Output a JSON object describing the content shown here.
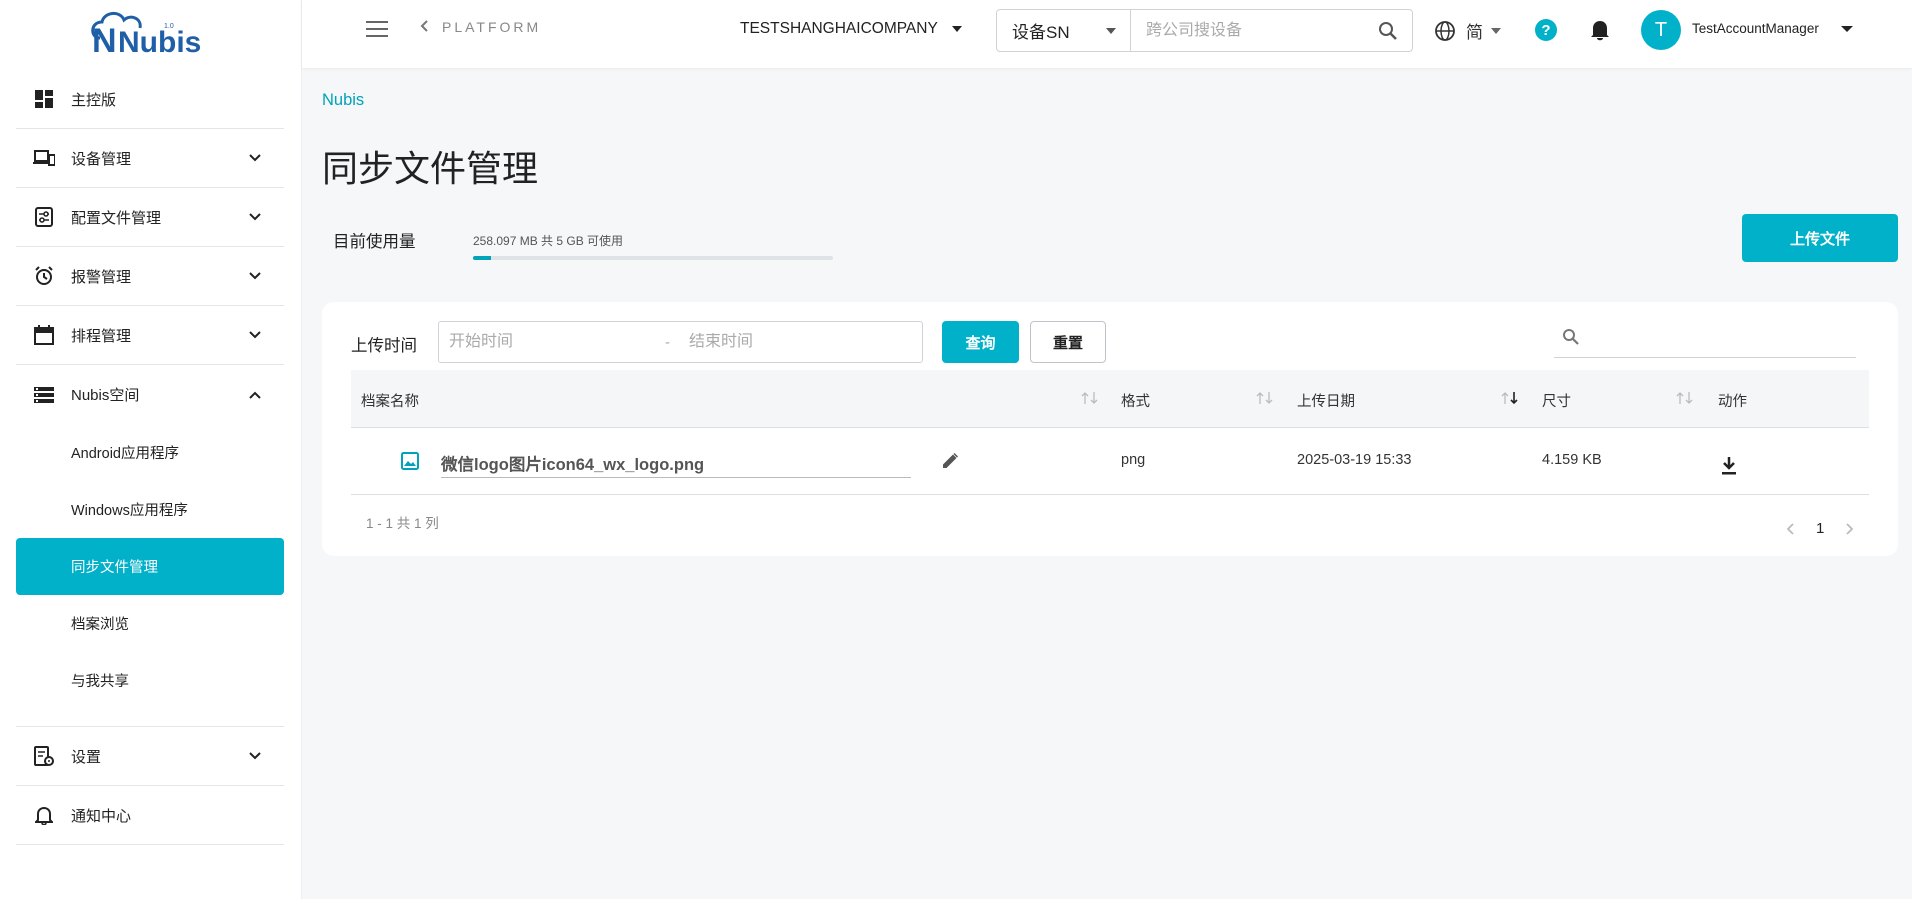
{
  "app": {
    "logo_text": "Nubis",
    "logo_version": "1.0"
  },
  "sidebar": {
    "items": [
      {
        "label": "主控版",
        "icon": "dashboard-icon",
        "expandable": false
      },
      {
        "label": "设备管理",
        "icon": "devices-icon",
        "expandable": true
      },
      {
        "label": "配置文件管理",
        "icon": "config-file-icon",
        "expandable": true
      },
      {
        "label": "报警管理",
        "icon": "alarm-icon",
        "expandable": true
      },
      {
        "label": "排程管理",
        "icon": "calendar-icon",
        "expandable": true
      },
      {
        "label": "Nubis空间",
        "icon": "storage-icon",
        "expandable": true,
        "expanded": true
      }
    ],
    "sub_items": [
      {
        "label": "Android应用程序",
        "active": false
      },
      {
        "label": "Windows应用程序",
        "active": false
      },
      {
        "label": "同步文件管理",
        "active": true
      },
      {
        "label": "档案浏览",
        "active": false
      },
      {
        "label": "与我共享",
        "active": false
      }
    ],
    "bottom_items": [
      {
        "label": "设置",
        "icon": "settings-doc-icon",
        "expandable": true
      },
      {
        "label": "通知中心",
        "icon": "notification-bell-icon",
        "expandable": false
      }
    ]
  },
  "header": {
    "back_label": "PLATFORM",
    "company": "TESTSHANGHAICOMPANY",
    "search_select": "设备SN",
    "search_placeholder": "跨公司搜设备",
    "language": "简",
    "help": "?",
    "avatar_letter": "T",
    "username": "TestAccountManager"
  },
  "breadcrumb": "Nubis",
  "page_title": "同步文件管理",
  "usage": {
    "label": "目前使用量",
    "text": "258.097 MB 共 5 GB 可使用",
    "fraction": 0.0504
  },
  "upload_button": "上传文件",
  "filter": {
    "label": "上传时间",
    "start_placeholder": "开始时间",
    "separator": "-",
    "end_placeholder": "结束时间",
    "query_button": "查询",
    "reset_button": "重置"
  },
  "table": {
    "headers": {
      "name": "档案名称",
      "format": "格式",
      "date": "上传日期",
      "size": "尺寸",
      "action": "动作"
    },
    "rows": [
      {
        "name": "微信logo图片icon64_wx_logo.png",
        "format": "png",
        "date": "2025-03-19 15:33",
        "size": "4.159 KB"
      }
    ]
  },
  "pagination": {
    "info": "1 - 1 共 1 列",
    "current_page": "1"
  },
  "colors": {
    "accent": "#00b1c9",
    "link": "#00a3b8"
  }
}
